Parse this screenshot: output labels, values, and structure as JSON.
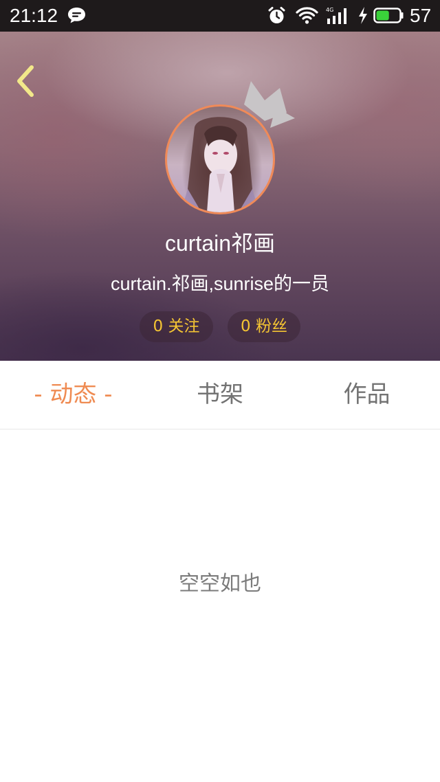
{
  "status_bar": {
    "time": "21:12",
    "battery_level": "57",
    "battery_fill_fraction": 0.57,
    "network": "4G",
    "icons": [
      "message-icon",
      "alarm-icon",
      "wifi-icon",
      "signal-icon",
      "charging-icon",
      "battery-icon"
    ]
  },
  "header": {
    "back_icon": "chevron-left-icon",
    "badge_icon": "crown-icon",
    "username": "curtain祁画",
    "bio": "curtain.祁画,sunrise的一员",
    "stats": {
      "follow_label": "0 关注",
      "fans_label": "0 粉丝"
    }
  },
  "tabs": [
    {
      "label": "- 动态 -",
      "active": true
    },
    {
      "label": "书架",
      "active": false
    },
    {
      "label": "作品",
      "active": false
    }
  ],
  "content": {
    "empty_text": "空空如也"
  },
  "colors": {
    "accent": "#ef8b52",
    "stat_text": "#f5c533",
    "tab_inactive": "#737373",
    "empty_text": "#7b7b7b"
  }
}
